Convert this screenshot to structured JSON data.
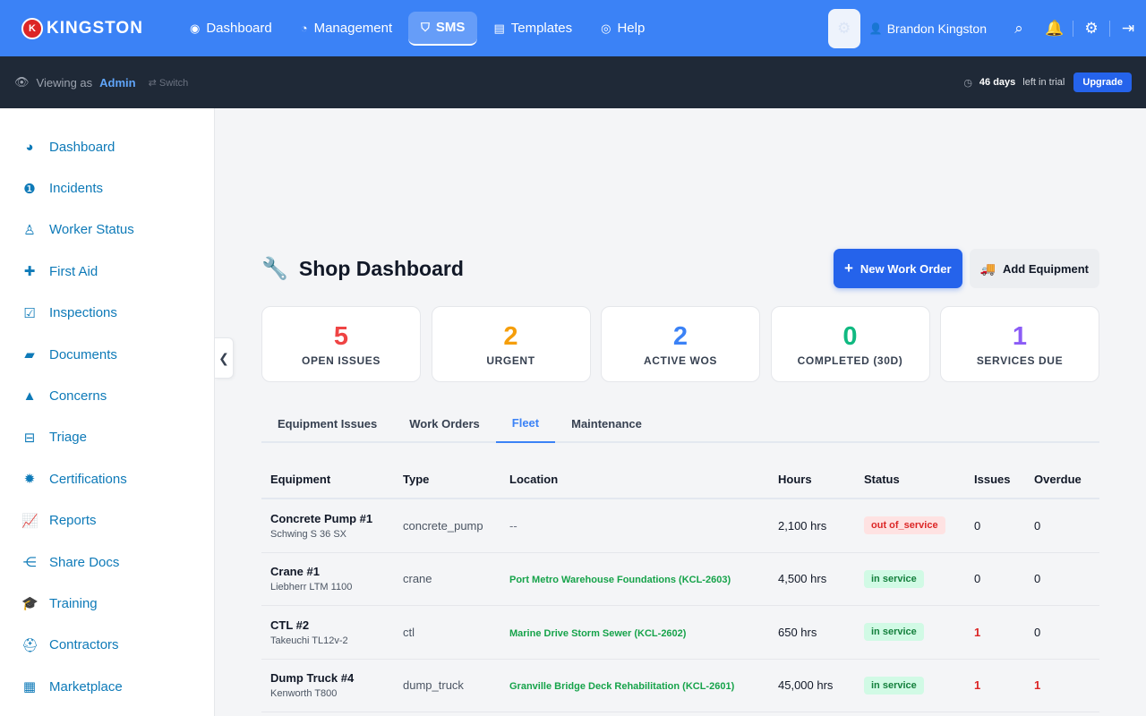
{
  "brand": {
    "logo_letter": "K",
    "name": "KINGSTON"
  },
  "nav": [
    {
      "label": "Dashboard",
      "icon": "gauge-icon",
      "glyph": "◉"
    },
    {
      "label": "Management",
      "icon": "pie-chart-icon",
      "glyph": "◔"
    },
    {
      "label": "SMS",
      "icon": "shield-icon",
      "glyph": "⛉",
      "active": true
    },
    {
      "label": "Templates",
      "icon": "clipboard-icon",
      "glyph": "▤"
    },
    {
      "label": "Help",
      "icon": "lifebuoy-icon",
      "glyph": "◎"
    }
  ],
  "top": {
    "user_name": "Brandon Kingston"
  },
  "subbar": {
    "viewing_prefix": "Viewing as",
    "role": "Admin",
    "switch_label": "⇄ Switch",
    "trial_days": "46 days",
    "trial_suffix": "left in trial",
    "upgrade_label": "Upgrade"
  },
  "sidebar": [
    {
      "label": "Dashboard",
      "icon": "gauge-icon",
      "glyph": "◕"
    },
    {
      "label": "Incidents",
      "icon": "alert-circle-icon",
      "glyph": "❶"
    },
    {
      "label": "Worker Status",
      "icon": "worker-icon",
      "glyph": "♙"
    },
    {
      "label": "First Aid",
      "icon": "first-aid-icon",
      "glyph": "✚"
    },
    {
      "label": "Inspections",
      "icon": "clipboard-check-icon",
      "glyph": "☑"
    },
    {
      "label": "Documents",
      "icon": "folder-open-icon",
      "glyph": "▰"
    },
    {
      "label": "Concerns",
      "icon": "warning-triangle-icon",
      "glyph": "▲"
    },
    {
      "label": "Triage",
      "icon": "inbox-icon",
      "glyph": "⊟"
    },
    {
      "label": "Certifications",
      "icon": "certificate-icon",
      "glyph": "✹"
    },
    {
      "label": "Reports",
      "icon": "line-chart-icon",
      "glyph": "📈"
    },
    {
      "label": "Share Docs",
      "icon": "share-icon",
      "glyph": "⋲"
    },
    {
      "label": "Training",
      "icon": "graduation-cap-icon",
      "glyph": "🎓"
    },
    {
      "label": "Contractors",
      "icon": "hard-hat-icon",
      "glyph": "⛑"
    },
    {
      "label": "Marketplace",
      "icon": "store-icon",
      "glyph": "▦"
    }
  ],
  "page": {
    "title": "Shop Dashboard",
    "new_work_order_label": "New Work Order",
    "add_equipment_label": "Add Equipment"
  },
  "stats": [
    {
      "value": "5",
      "label": "OPEN ISSUES",
      "color": "#ef4444"
    },
    {
      "value": "2",
      "label": "URGENT",
      "color": "#f59e0b"
    },
    {
      "value": "2",
      "label": "ACTIVE WOS",
      "color": "#3b82f6"
    },
    {
      "value": "0",
      "label": "COMPLETED (30D)",
      "color": "#10b981"
    },
    {
      "value": "1",
      "label": "SERVICES DUE",
      "color": "#8b5cf6"
    }
  ],
  "tabs": [
    {
      "label": "Equipment Issues",
      "active": false
    },
    {
      "label": "Work Orders",
      "active": false
    },
    {
      "label": "Fleet",
      "active": true
    },
    {
      "label": "Maintenance",
      "active": false
    }
  ],
  "table": {
    "headers": [
      "Equipment",
      "Type",
      "Location",
      "Hours",
      "Status",
      "Issues",
      "Overdue"
    ],
    "rows": [
      {
        "name": "Concrete Pump #1",
        "model": "Schwing S 36 SX",
        "type": "concrete_pump",
        "location": "--",
        "hours": "2,100 hrs",
        "status": "out of_service",
        "status_kind": "oos",
        "issues": "0",
        "overdue": "0"
      },
      {
        "name": "Crane #1",
        "model": "Liebherr LTM 1100",
        "type": "crane",
        "location": "Port Metro Warehouse Foundations (KCL-2603)",
        "hours": "4,500 hrs",
        "status": "in service",
        "status_kind": "ins",
        "issues": "0",
        "overdue": "0"
      },
      {
        "name": "CTL #2",
        "model": "Takeuchi TL12v-2",
        "type": "ctl",
        "location": "Marine Drive Storm Sewer (KCL-2602)",
        "hours": "650 hrs",
        "status": "in service",
        "status_kind": "ins",
        "issues": "1",
        "overdue": "0"
      },
      {
        "name": "Dump Truck #4",
        "model": "Kenworth T800",
        "type": "dump_truck",
        "location": "Granville Bridge Deck Rehabilitation (KCL-2601)",
        "hours": "45,000 hrs",
        "status": "in service",
        "status_kind": "ins",
        "issues": "1",
        "overdue": "1"
      }
    ]
  }
}
